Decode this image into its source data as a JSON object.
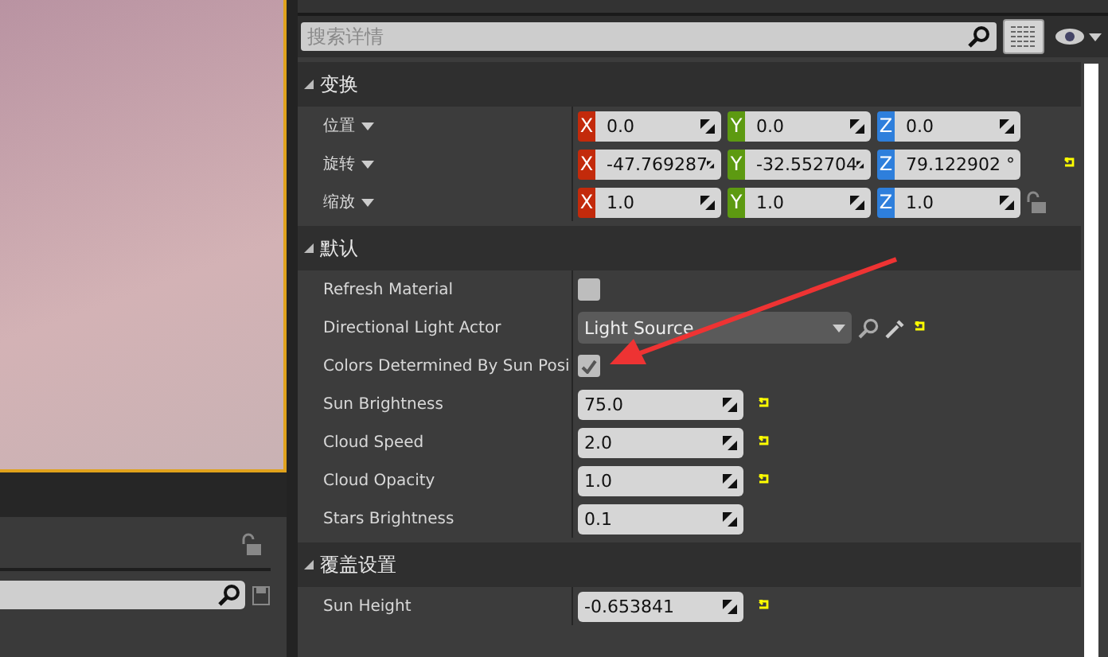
{
  "details": {
    "search": {
      "placeholder": "搜索详情"
    },
    "sections": [
      {
        "title": "变换",
        "expanded": true,
        "rows": [
          {
            "kind": "vector",
            "label": "位置",
            "values": [
              {
                "axis": "X",
                "value": "0.0"
              },
              {
                "axis": "Y",
                "value": "0.0"
              },
              {
                "axis": "Z",
                "value": "0.0"
              }
            ],
            "reset": false
          },
          {
            "kind": "vector",
            "label": "旋转",
            "values": [
              {
                "axis": "X",
                "value": "-47.769287"
              },
              {
                "axis": "Y",
                "value": "-32.552704"
              },
              {
                "axis": "Z",
                "value": "79.122902 °"
              }
            ],
            "reset": true
          },
          {
            "kind": "vector",
            "label": "缩放",
            "values": [
              {
                "axis": "X",
                "value": "1.0"
              },
              {
                "axis": "Y",
                "value": "1.0"
              },
              {
                "axis": "Z",
                "value": "1.0"
              }
            ],
            "reset": false,
            "locked": false
          }
        ]
      },
      {
        "title": "默认",
        "expanded": true,
        "rows": [
          {
            "kind": "checkbox",
            "label": "Refresh Material",
            "checked": false,
            "reset": false
          },
          {
            "kind": "dropdown",
            "label": "Directional Light Actor",
            "value": "Light Source",
            "reset": true
          },
          {
            "kind": "checkbox",
            "label": "Colors Determined By Sun Posi",
            "checked": true,
            "reset": false
          },
          {
            "kind": "number",
            "label": "Sun Brightness",
            "value": "75.0",
            "reset": true
          },
          {
            "kind": "number",
            "label": "Cloud Speed",
            "value": "2.0",
            "reset": true
          },
          {
            "kind": "number",
            "label": "Cloud Opacity",
            "value": "1.0",
            "reset": true
          },
          {
            "kind": "number",
            "label": "Stars Brightness",
            "value": "0.1",
            "reset": false
          }
        ]
      },
      {
        "title": "覆盖设置",
        "expanded": true,
        "rows": [
          {
            "kind": "number",
            "label": "Sun Height",
            "value": "-0.653841",
            "reset": true
          }
        ]
      }
    ]
  }
}
